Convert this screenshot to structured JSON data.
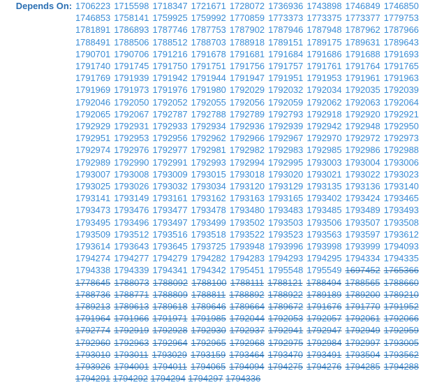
{
  "depends_label": "Depends On:",
  "open_ids": [
    "1706223",
    "1715598",
    "1718347",
    "1721671",
    "1728072",
    "1736936",
    "1743898",
    "1746849",
    "1746850",
    "1746853",
    "1758141",
    "1759925",
    "1759992",
    "1770859",
    "1773373",
    "1773375",
    "1773377",
    "1779753",
    "1781891",
    "1786893",
    "1787746",
    "1787753",
    "1787902",
    "1787946",
    "1787948",
    "1787962",
    "1787966",
    "1788491",
    "1788506",
    "1788512",
    "1788703",
    "1788918",
    "1789151",
    "1789175",
    "1789631",
    "1789643",
    "1790701",
    "1790706",
    "1791216",
    "1791678",
    "1791681",
    "1791684",
    "1791686",
    "1791688",
    "1791693",
    "1791740",
    "1791745",
    "1791750",
    "1791751",
    "1791756",
    "1791757",
    "1791761",
    "1791764",
    "1791765",
    "1791769",
    "1791939",
    "1791942",
    "1791944",
    "1791947",
    "1791951",
    "1791953",
    "1791961",
    "1791963",
    "1791969",
    "1791973",
    "1791976",
    "1791980",
    "1792029",
    "1792032",
    "1792034",
    "1792035",
    "1792039",
    "1792046",
    "1792050",
    "1792052",
    "1792055",
    "1792056",
    "1792059",
    "1792062",
    "1792063",
    "1792064",
    "1792065",
    "1792067",
    "1792787",
    "1792788",
    "1792789",
    "1792793",
    "1792918",
    "1792920",
    "1792921",
    "1792929",
    "1792931",
    "1792933",
    "1792934",
    "1792936",
    "1792939",
    "1792942",
    "1792948",
    "1792950",
    "1792951",
    "1792953",
    "1792956",
    "1792962",
    "1792966",
    "1792967",
    "1792970",
    "1792972",
    "1792973",
    "1792974",
    "1792976",
    "1792977",
    "1792981",
    "1792982",
    "1792983",
    "1792985",
    "1792986",
    "1792988",
    "1792989",
    "1792990",
    "1792991",
    "1792993",
    "1792994",
    "1792995",
    "1793003",
    "1793004",
    "1793006",
    "1793007",
    "1793008",
    "1793009",
    "1793015",
    "1793018",
    "1793020",
    "1793021",
    "1793022",
    "1793023",
    "1793025",
    "1793026",
    "1793032",
    "1793034",
    "1793120",
    "1793129",
    "1793135",
    "1793136",
    "1793140",
    "1793141",
    "1793149",
    "1793161",
    "1793162",
    "1793163",
    "1793165",
    "1793402",
    "1793424",
    "1793465",
    "1793473",
    "1793476",
    "1793477",
    "1793478",
    "1793480",
    "1793483",
    "1793485",
    "1793489",
    "1793493",
    "1793495",
    "1793496",
    "1793497",
    "1793499",
    "1793502",
    "1793503",
    "1793506",
    "1793507",
    "1793508",
    "1793509",
    "1793512",
    "1793516",
    "1793518",
    "1793522",
    "1793523",
    "1793563",
    "1793597",
    "1793612",
    "1793614",
    "1793643",
    "1793645",
    "1793725",
    "1793948",
    "1793996",
    "1793998",
    "1793999",
    "1794093",
    "1794274",
    "1794277",
    "1794279",
    "1794282",
    "1794283",
    "1794293",
    "1794295",
    "1794334",
    "1794335",
    "1794338",
    "1794339",
    "1794341",
    "1794342",
    "1795451",
    "1795548",
    "1795549"
  ],
  "closed_ids": [
    "1697452",
    "1765366",
    "1778645",
    "1788073",
    "1788092",
    "1788100",
    "1788111",
    "1788121",
    "1788494",
    "1788565",
    "1788660",
    "1788736",
    "1788771",
    "1788809",
    "1788811",
    "1788892",
    "1788922",
    "1789189",
    "1789200",
    "1789210",
    "1789213",
    "1789613",
    "1789618",
    "1789646",
    "1789664",
    "1789672",
    "1791676",
    "1791770",
    "1791952",
    "1791964",
    "1791966",
    "1791971",
    "1791985",
    "1792044",
    "1792053",
    "1792057",
    "1792061",
    "1792066",
    "1792774",
    "1792919",
    "1792928",
    "1792930",
    "1792937",
    "1792941",
    "1792947",
    "1792949",
    "1792959",
    "1792960",
    "1792963",
    "1792964",
    "1792965",
    "1792968",
    "1792975",
    "1792984",
    "1792997",
    "1793005",
    "1793010",
    "1793011",
    "1793029",
    "1793159",
    "1793464",
    "1793470",
    "1793491",
    "1793504",
    "1793562",
    "1793926",
    "1794001",
    "1794011",
    "1794065",
    "1794094",
    "1794275",
    "1794276",
    "1794285",
    "1794288",
    "1794291",
    "1794292",
    "1794294",
    "1794297",
    "1794336"
  ],
  "colors": {
    "label": "#2a6fb3",
    "link": "#3a8dd6",
    "strike": "#2b5c8a"
  }
}
